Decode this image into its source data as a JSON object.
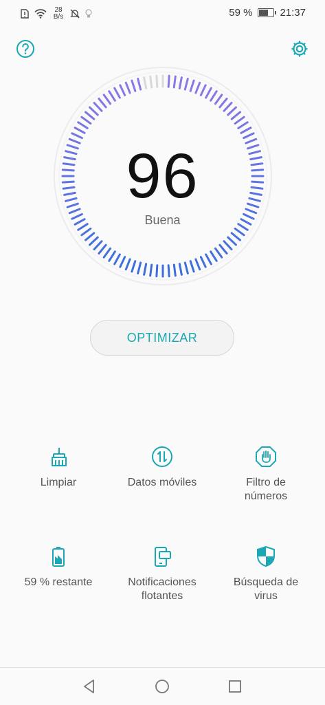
{
  "statusbar": {
    "net_speed_value": "28",
    "net_speed_unit": "B/s",
    "battery_percent_text": "59 %",
    "battery_level": 0.59,
    "time": "21:37"
  },
  "dial": {
    "score": "96",
    "status": "Buena",
    "filled_fraction": 0.96,
    "colors": {
      "start": "#3b6fdc",
      "end": "#8a78e6",
      "empty": "#d9d9d9"
    }
  },
  "actions": {
    "optimize_label": "OPTIMIZAR"
  },
  "tiles": [
    {
      "label": "Limpiar",
      "icon": "broom-icon"
    },
    {
      "label": "Datos móviles",
      "icon": "data-transfer-icon"
    },
    {
      "label": "Filtro de\nnúmeros",
      "icon": "block-hand-icon"
    },
    {
      "label": "59 % restante",
      "icon": "battery-icon"
    },
    {
      "label": "Notificaciones\nflotantes",
      "icon": "floating-window-icon"
    },
    {
      "label": "Búsqueda de\nvirus",
      "icon": "shield-icon"
    }
  ],
  "theme": {
    "accent": "#1aa8b4"
  }
}
